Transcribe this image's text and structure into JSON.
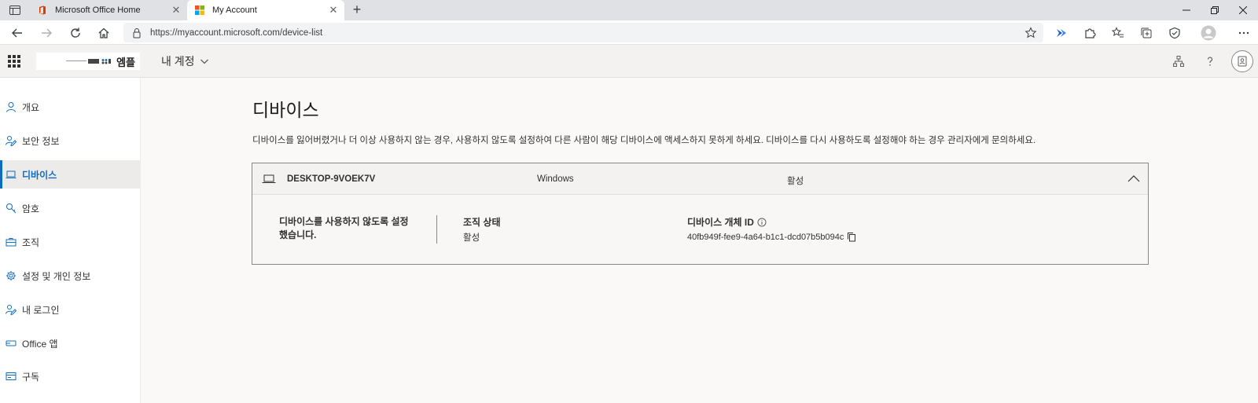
{
  "browser": {
    "tabs": [
      {
        "title": "Microsoft Office Home",
        "icon": "office-icon"
      },
      {
        "title": "My Account",
        "icon": "microsoft-icon"
      }
    ],
    "url": "https://myaccount.microsoft.com/device-list"
  },
  "header": {
    "logo_text": "엠플",
    "my_account_label": "내 계정"
  },
  "sidebar": {
    "items": [
      {
        "label": "개요",
        "icon": "person-icon"
      },
      {
        "label": "보안 정보",
        "icon": "security-info-icon"
      },
      {
        "label": "디바이스",
        "icon": "laptop-icon"
      },
      {
        "label": "암호",
        "icon": "key-icon"
      },
      {
        "label": "조직",
        "icon": "briefcase-icon"
      },
      {
        "label": "설정 및 개인 정보",
        "icon": "gear-icon"
      },
      {
        "label": "내 로그인",
        "icon": "signin-icon"
      },
      {
        "label": "Office 앱",
        "icon": "apps-icon"
      },
      {
        "label": "구독",
        "icon": "subscription-icon"
      }
    ]
  },
  "main": {
    "title": "디바이스",
    "description": "디바이스를 잃어버렸거나 더 이상 사용하지 않는 경우, 사용하지 않도록 설정하여 다른 사람이 해당 디바이스에 액세스하지 못하게 하세요. 디바이스를 다시 사용하도록 설정해야 하는 경우 관리자에게 문의하세요.",
    "device": {
      "name": "DESKTOP-9VOEK7V",
      "os": "Windows",
      "state": "활성",
      "disabled_message": "디바이스를 사용하지 않도록 설정했습니다.",
      "org_state_label": "조직 상태",
      "org_state_value": "활성",
      "object_id_label": "디바이스 개체 ID",
      "object_id_value": "40fb949f-fee9-4a64-b1c1-dcd07b5b094c"
    }
  },
  "colors": {
    "accent": "#0f6cbd",
    "header_bg": "#f3f2f1",
    "page_bg": "#faf9f8"
  }
}
